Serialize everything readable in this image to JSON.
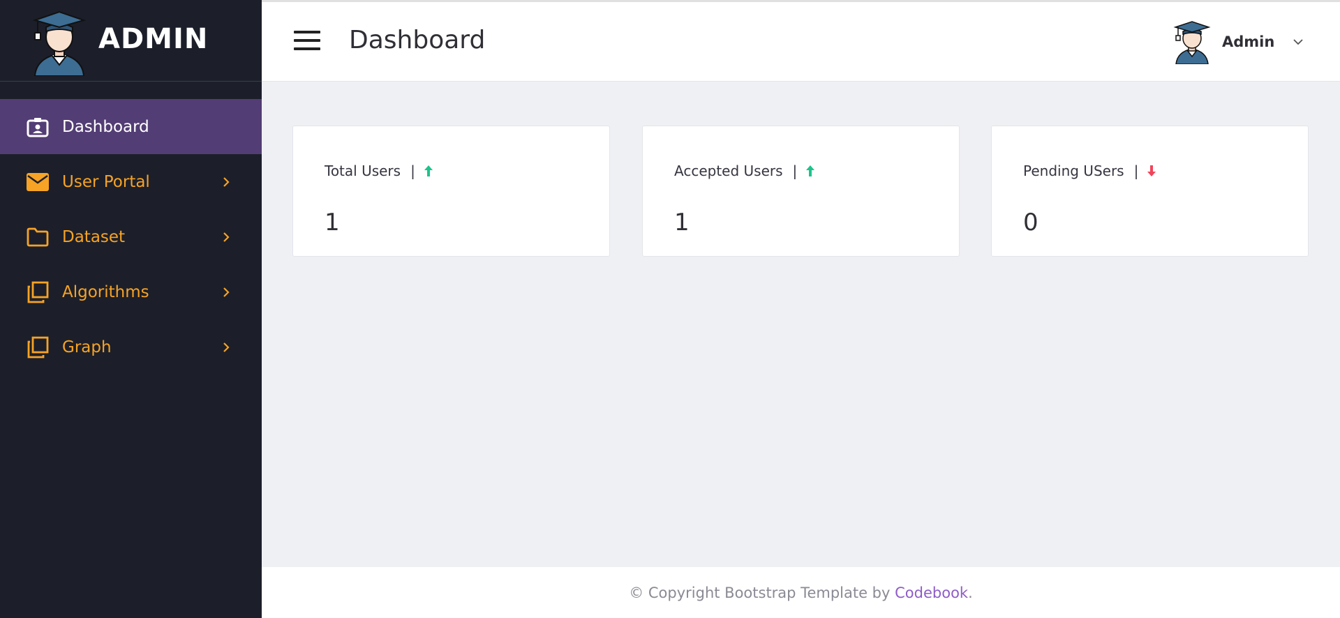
{
  "brand": {
    "title": "ADMIN"
  },
  "sidebar": {
    "items": [
      {
        "label": "Dashboard",
        "icon": "id-badge-icon",
        "active": true
      },
      {
        "label": "User Portal",
        "icon": "envelope-icon",
        "active": false
      },
      {
        "label": "Dataset",
        "icon": "folder-icon",
        "active": false
      },
      {
        "label": "Algorithms",
        "icon": "copy-icon",
        "active": false
      },
      {
        "label": "Graph",
        "icon": "copy-icon",
        "active": false
      }
    ]
  },
  "header": {
    "title": "Dashboard",
    "user_name": "Admin"
  },
  "cards": [
    {
      "title": "Total Users",
      "separator": "|",
      "trend": "up",
      "value": "1"
    },
    {
      "title": "Accepted Users",
      "separator": "|",
      "trend": "up",
      "value": "1"
    },
    {
      "title": "Pending USers",
      "separator": "|",
      "trend": "down",
      "value": "0"
    }
  ],
  "footer": {
    "prefix": "© Copyright Bootstrap Template by ",
    "link_text": "Codebook",
    "suffix": "."
  },
  "colors": {
    "sidebar_bg": "#1c1f2a",
    "active_item": "#533d75",
    "accent_orange": "#f7a325",
    "trend_up": "#1ec38b",
    "trend_down": "#f0455a",
    "link": "#8e5cc9"
  }
}
